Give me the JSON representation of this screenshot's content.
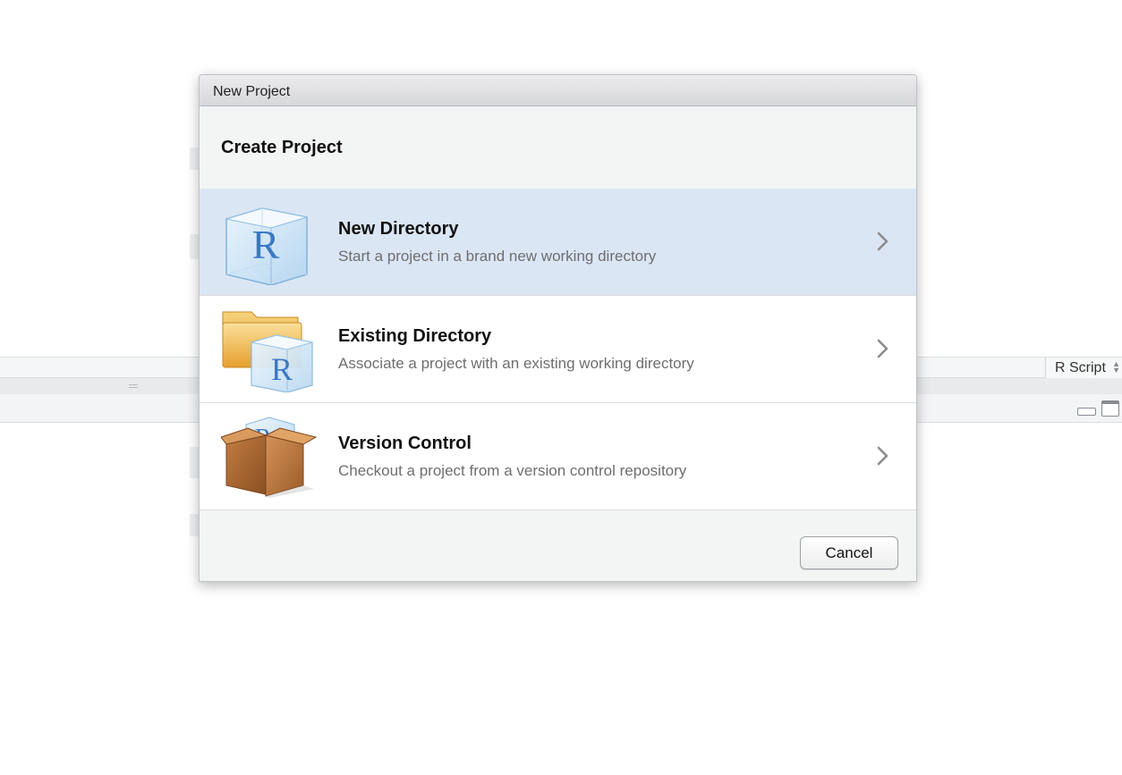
{
  "background": {
    "script_type_label": "R Script"
  },
  "dialog": {
    "window_title": "New Project",
    "heading": "Create Project",
    "options": [
      {
        "title": "New Directory",
        "description": "Start a project in a brand new working directory",
        "icon": "r-cube-icon",
        "selected": true
      },
      {
        "title": "Existing Directory",
        "description": "Associate a project with an existing working directory",
        "icon": "folder-r-icon",
        "selected": false
      },
      {
        "title": "Version Control",
        "description": "Checkout a project from a version control repository",
        "icon": "box-r-icon",
        "selected": false
      }
    ],
    "cancel_label": "Cancel"
  },
  "colors": {
    "selected_row": "#dbe6f4",
    "dialog_bg": "#f3f4f4",
    "description_text": "#6e6e6e",
    "icon_blue": "#3b78c4",
    "folder_orange": "#e8a83a",
    "box_brown": "#b8753a"
  }
}
